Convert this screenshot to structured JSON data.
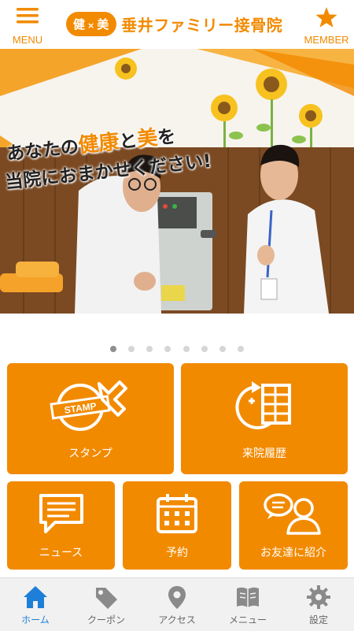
{
  "header": {
    "menu_label": "MENU",
    "member_label": "MEMBER",
    "logo_badge_left": "健",
    "logo_badge_x": "×",
    "logo_badge_right": "美",
    "clinic_name": "垂井ファミリー接骨院"
  },
  "hero": {
    "line1_a": "あなたの",
    "line1_b": "健康",
    "line1_c": "と",
    "line1_d": "美",
    "line1_e": "を",
    "line2": "当院におまかせください!"
  },
  "carousel": {
    "total": 8,
    "active_index": 0
  },
  "tiles": {
    "stamp_label": "スタンプ",
    "stamp_icon_text": "STAMP",
    "history_label": "来院履歴",
    "news_label": "ニュース",
    "reserve_label": "予約",
    "friend_label": "お友達に紹介"
  },
  "bottom_nav": [
    {
      "label": "ホーム",
      "icon": "home-icon",
      "active": true
    },
    {
      "label": "クーポン",
      "icon": "tag-icon",
      "active": false
    },
    {
      "label": "アクセス",
      "icon": "map-pin-icon",
      "active": false
    },
    {
      "label": "メニュー",
      "icon": "book-icon",
      "active": false
    },
    {
      "label": "設定",
      "icon": "gear-icon",
      "active": false
    }
  ],
  "colors": {
    "brand_orange": "#f28a00",
    "nav_active": "#1d7fd8",
    "nav_inactive": "#8a8a8a",
    "dot_active": "#8f8f8f",
    "dot_inactive": "#d6d6d6"
  }
}
